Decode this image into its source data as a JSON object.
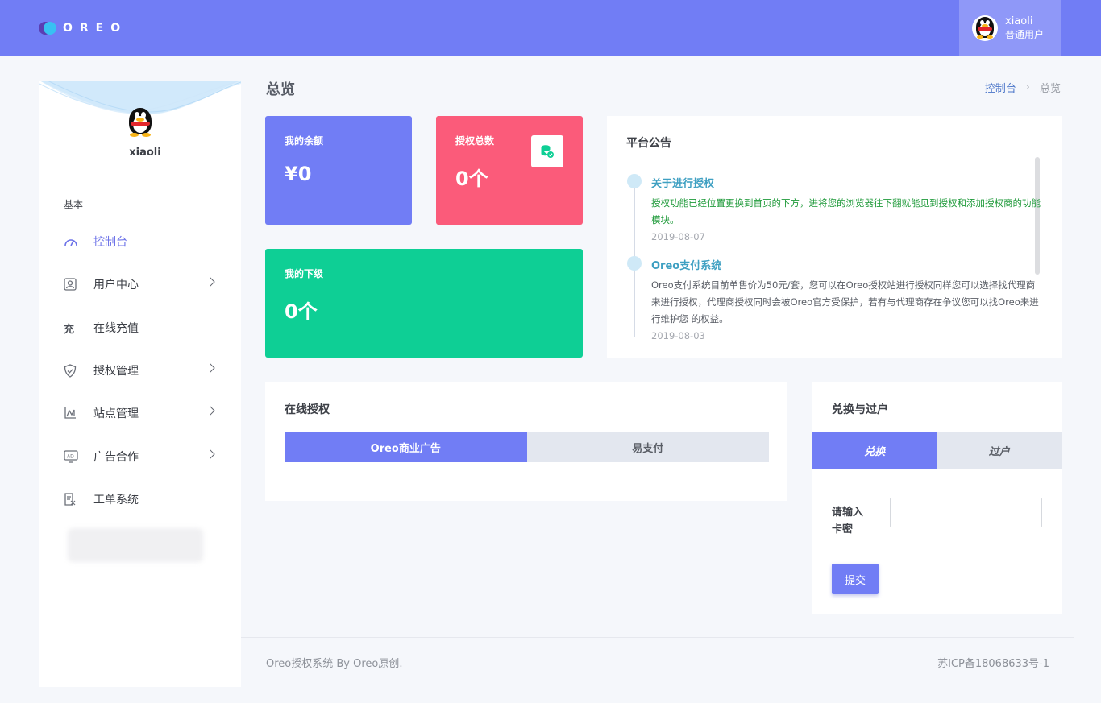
{
  "header": {
    "logo_text": "OREO",
    "user_name": "xiaoli",
    "user_role": "普通用户"
  },
  "sidebar": {
    "user_name": "xiaoli",
    "section_label": "基本",
    "items": [
      {
        "label": "控制台",
        "icon": "dashboard-icon",
        "active": true,
        "has_submenu": false
      },
      {
        "label": "用户中心",
        "icon": "user-card-icon",
        "active": false,
        "has_submenu": true
      },
      {
        "label": "在线充值",
        "icon_text": "充",
        "icon": "recharge-icon",
        "active": false,
        "has_submenu": false
      },
      {
        "label": "授权管理",
        "icon": "shield-icon",
        "active": false,
        "has_submenu": true
      },
      {
        "label": "站点管理",
        "icon": "chart-icon",
        "active": false,
        "has_submenu": true
      },
      {
        "label": "广告合作",
        "icon": "ad-icon",
        "active": false,
        "has_submenu": true
      },
      {
        "label": "工单系统",
        "icon": "ticket-icon",
        "active": false,
        "has_submenu": false
      }
    ]
  },
  "page": {
    "title": "总览",
    "breadcrumb_home": "控制台",
    "breadcrumb_current": "总览"
  },
  "stats": {
    "balance": {
      "label": "我的余额",
      "value": "¥0"
    },
    "total_auth": {
      "label": "授权总数",
      "value": "0个"
    },
    "subordinates": {
      "label": "我的下级",
      "value": "0个"
    }
  },
  "notice": {
    "title": "平台公告",
    "items": [
      {
        "title": "关于进行授权",
        "text": "授权功能已经位置更换到首页的下方，进将您的浏览器往下翻就能见到授权和添加授权商的功能模块。",
        "date": "2019-08-07",
        "text_color": "#1f9a3a"
      },
      {
        "title": "Oreo支付系统",
        "text": "Oreo支付系统目前单售价为50元/套，您可以在Oreo授权站进行授权同样您可以选择找代理商来进行授权，代理商授权同时会被Oreo官方受保护，若有与代理商存在争议您可以找Oreo来进行维护您 的权益。",
        "date": "2019-08-03",
        "text_color": "#5a5e66"
      }
    ]
  },
  "online_auth": {
    "title": "在线授权",
    "tabs": [
      "Oreo商业广告",
      "易支付"
    ],
    "active_tab": 0
  },
  "exchange": {
    "title": "兑换与过户",
    "tabs": [
      "兑换",
      "过户"
    ],
    "active_tab": 0,
    "input_label": "请输入卡密",
    "input_value": "",
    "submit_label": "提交"
  },
  "footer": {
    "left": "Oreo授权系统 By Oreo原创.",
    "right": "苏ICP备18068633号-1"
  },
  "colors": {
    "primary": "#717df5",
    "pink": "#fb5b7a",
    "green": "#0ecf95",
    "background": "#f5f7fb"
  }
}
